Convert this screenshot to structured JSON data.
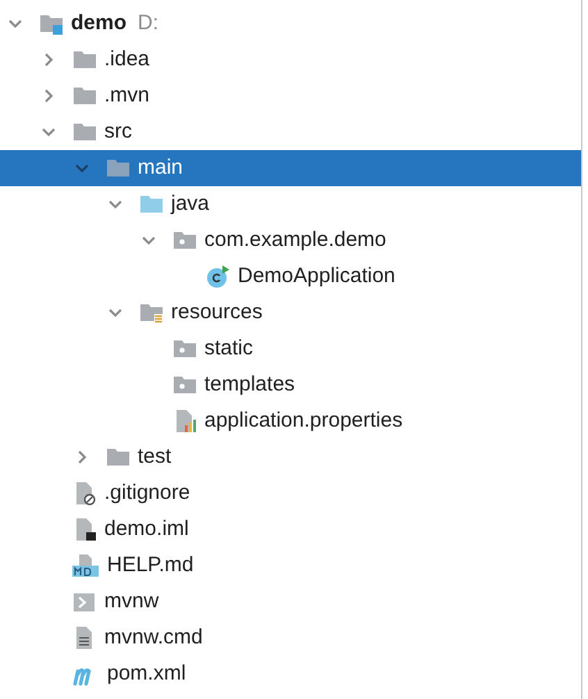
{
  "tree": [
    {
      "name": "demo",
      "kind": "module",
      "path": "D:",
      "expanded": true,
      "selected": false,
      "children": [
        {
          "name": ".idea",
          "kind": "folder",
          "expanded": false,
          "selected": false
        },
        {
          "name": ".mvn",
          "kind": "folder",
          "expanded": false,
          "selected": false
        },
        {
          "name": "src",
          "kind": "folder",
          "expanded": true,
          "selected": false,
          "children": [
            {
              "name": "main",
              "kind": "folder",
              "expanded": true,
              "selected": true,
              "children": [
                {
                  "name": "java",
                  "kind": "source",
                  "expanded": true,
                  "selected": false,
                  "children": [
                    {
                      "name": "com.example.demo",
                      "kind": "package",
                      "expanded": true,
                      "selected": false,
                      "children": [
                        {
                          "name": "DemoApplication",
                          "kind": "class",
                          "selected": false
                        }
                      ]
                    }
                  ]
                },
                {
                  "name": "resources",
                  "kind": "resources",
                  "expanded": true,
                  "selected": false,
                  "children": [
                    {
                      "name": "static",
                      "kind": "package",
                      "selected": false
                    },
                    {
                      "name": "templates",
                      "kind": "package",
                      "selected": false
                    },
                    {
                      "name": "application.properties",
                      "kind": "properties",
                      "selected": false
                    }
                  ]
                }
              ]
            },
            {
              "name": "test",
              "kind": "folder",
              "expanded": false,
              "selected": false
            }
          ]
        },
        {
          "name": ".gitignore",
          "kind": "gitignore",
          "selected": false
        },
        {
          "name": "demo.iml",
          "kind": "iml",
          "selected": false
        },
        {
          "name": "HELP.md",
          "kind": "markdown",
          "selected": false
        },
        {
          "name": "mvnw",
          "kind": "shell",
          "selected": false
        },
        {
          "name": "mvnw.cmd",
          "kind": "text",
          "selected": false
        },
        {
          "name": "pom.xml",
          "kind": "maven",
          "selected": false
        }
      ]
    }
  ]
}
